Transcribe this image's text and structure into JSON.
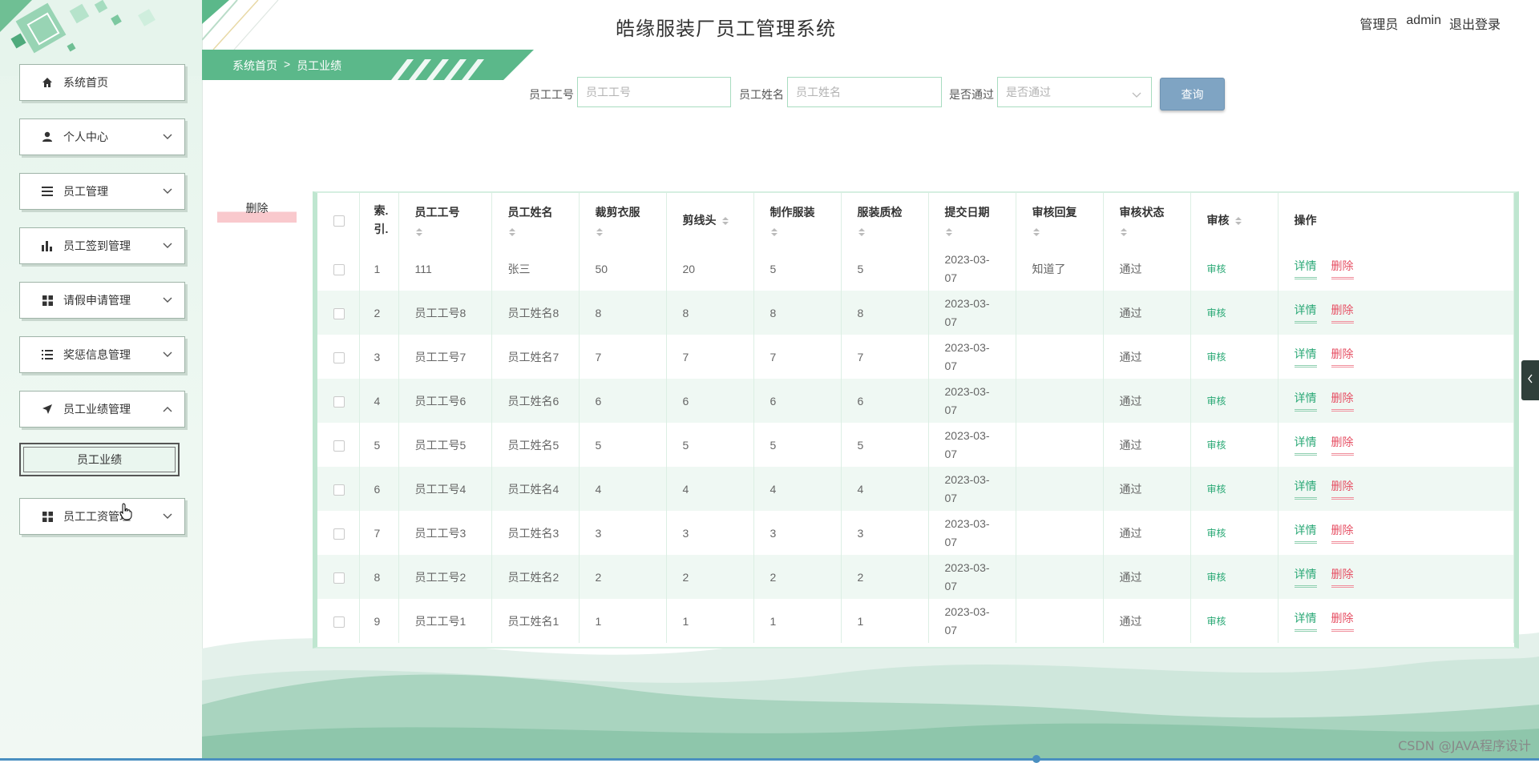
{
  "header": {
    "app_title": "皓缘服装厂员工管理系统",
    "user_role": "管理员",
    "username": "admin",
    "logout_label": "退出登录"
  },
  "sidebar": {
    "items": [
      {
        "label": "系统首页",
        "icon": "home-icon",
        "expanded": false,
        "has_chevron": false
      },
      {
        "label": "个人中心",
        "icon": "user-icon",
        "expanded": false,
        "has_chevron": true
      },
      {
        "label": "员工管理",
        "icon": "list-icon",
        "expanded": false,
        "has_chevron": true
      },
      {
        "label": "员工签到管理",
        "icon": "bar-chart-icon",
        "expanded": false,
        "has_chevron": true
      },
      {
        "label": "请假申请管理",
        "icon": "grid-icon",
        "expanded": false,
        "has_chevron": true
      },
      {
        "label": "奖惩信息管理",
        "icon": "list-check-icon",
        "expanded": false,
        "has_chevron": true
      },
      {
        "label": "员工业绩管理",
        "icon": "send-icon",
        "expanded": true,
        "has_chevron": true
      },
      {
        "label": "员工工资管理",
        "icon": "grid-icon",
        "expanded": false,
        "has_chevron": true
      }
    ],
    "sub_item": {
      "label": "员工业绩",
      "active": true
    }
  },
  "breadcrumb": {
    "home": "系统首页",
    "separator": ">",
    "current": "员工业绩"
  },
  "search": {
    "employee_no_label": "员工工号",
    "employee_no_placeholder": "员工工号",
    "employee_name_label": "员工姓名",
    "employee_name_placeholder": "员工姓名",
    "passed_label": "是否通过",
    "passed_placeholder": "是否通过",
    "query_label": "查询"
  },
  "actions": {
    "delete_label": "删除"
  },
  "table": {
    "columns": [
      "索引",
      "员工工号",
      "员工姓名",
      "裁剪衣服",
      "剪线头",
      "制作服装",
      "服装质检",
      "提交日期",
      "审核回复",
      "审核状态",
      "审核",
      "操作"
    ],
    "index_header_top": "索.",
    "index_header_bottom": "引.",
    "rows": [
      {
        "index": "1",
        "employee_no": "111",
        "employee_name": "张三",
        "cut_clothes": "50",
        "trim_threads": "20",
        "make_clothes": "5",
        "quality_check": "5",
        "date_top": "2023-03-",
        "date_bottom": "07",
        "reply": "知道了",
        "status": "通过",
        "audit": "审核",
        "detail": "详情",
        "delete": "删除"
      },
      {
        "index": "2",
        "employee_no": "员工工号8",
        "employee_name": "员工姓名8",
        "cut_clothes": "8",
        "trim_threads": "8",
        "make_clothes": "8",
        "quality_check": "8",
        "date_top": "2023-03-",
        "date_bottom": "07",
        "reply": "",
        "status": "通过",
        "audit": "审核",
        "detail": "详情",
        "delete": "删除"
      },
      {
        "index": "3",
        "employee_no": "员工工号7",
        "employee_name": "员工姓名7",
        "cut_clothes": "7",
        "trim_threads": "7",
        "make_clothes": "7",
        "quality_check": "7",
        "date_top": "2023-03-",
        "date_bottom": "07",
        "reply": "",
        "status": "通过",
        "audit": "审核",
        "detail": "详情",
        "delete": "删除"
      },
      {
        "index": "4",
        "employee_no": "员工工号6",
        "employee_name": "员工姓名6",
        "cut_clothes": "6",
        "trim_threads": "6",
        "make_clothes": "6",
        "quality_check": "6",
        "date_top": "2023-03-",
        "date_bottom": "07",
        "reply": "",
        "status": "通过",
        "audit": "审核",
        "detail": "详情",
        "delete": "删除"
      },
      {
        "index": "5",
        "employee_no": "员工工号5",
        "employee_name": "员工姓名5",
        "cut_clothes": "5",
        "trim_threads": "5",
        "make_clothes": "5",
        "quality_check": "5",
        "date_top": "2023-03-",
        "date_bottom": "07",
        "reply": "",
        "status": "通过",
        "audit": "审核",
        "detail": "详情",
        "delete": "删除"
      },
      {
        "index": "6",
        "employee_no": "员工工号4",
        "employee_name": "员工姓名4",
        "cut_clothes": "4",
        "trim_threads": "4",
        "make_clothes": "4",
        "quality_check": "4",
        "date_top": "2023-03-",
        "date_bottom": "07",
        "reply": "",
        "status": "通过",
        "audit": "审核",
        "detail": "详情",
        "delete": "删除"
      },
      {
        "index": "7",
        "employee_no": "员工工号3",
        "employee_name": "员工姓名3",
        "cut_clothes": "3",
        "trim_threads": "3",
        "make_clothes": "3",
        "quality_check": "3",
        "date_top": "2023-03-",
        "date_bottom": "07",
        "reply": "",
        "status": "通过",
        "audit": "审核",
        "detail": "详情",
        "delete": "删除"
      },
      {
        "index": "8",
        "employee_no": "员工工号2",
        "employee_name": "员工姓名2",
        "cut_clothes": "2",
        "trim_threads": "2",
        "make_clothes": "2",
        "quality_check": "2",
        "date_top": "2023-03-",
        "date_bottom": "07",
        "reply": "",
        "status": "通过",
        "audit": "审核",
        "detail": "详情",
        "delete": "删除"
      },
      {
        "index": "9",
        "employee_no": "员工工号1",
        "employee_name": "员工姓名1",
        "cut_clothes": "1",
        "trim_threads": "1",
        "make_clothes": "1",
        "quality_check": "1",
        "date_top": "2023-03-",
        "date_bottom": "07",
        "reply": "",
        "status": "通过",
        "audit": "审核",
        "detail": "详情",
        "delete": "删除"
      }
    ]
  },
  "watermark": "CSDN @JAVA程序设计",
  "colors": {
    "accent_green": "#5bb88a",
    "link_green": "#2aa876",
    "delete_red": "#e65064",
    "query_blue": "#7fa4c3"
  }
}
